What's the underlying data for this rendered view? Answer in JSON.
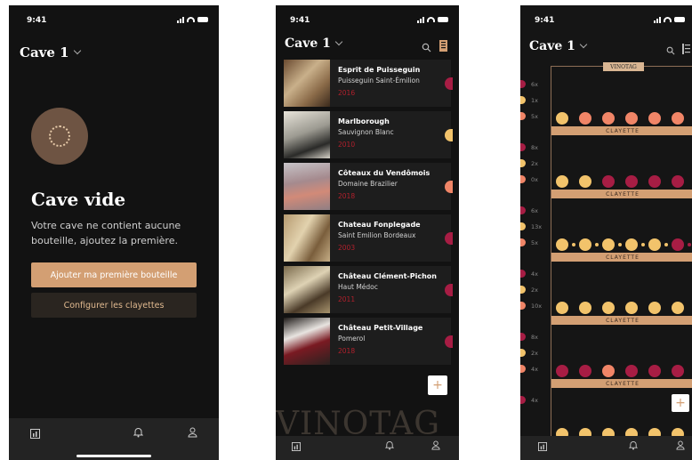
{
  "colors": {
    "accent": "#d39f73",
    "background": "#121212",
    "red_wine": "#a71d44",
    "white_wine": "#f2c36b",
    "rose_wine": "#f08567"
  },
  "status_time": "9:41",
  "screen1": {
    "cellar_name": "Cave 1",
    "empty_title": "Cave vide",
    "empty_message": "Votre cave ne contient aucune bouteille, ajoutez la première.",
    "add_button": "Ajouter ma première bouteille",
    "configure_button": "Configurer les clayettes"
  },
  "screen2": {
    "cellar_name": "Cave 1",
    "wines": [
      {
        "name": "Esprit de Puisseguin",
        "region": "Puisseguin Saint-Émilion",
        "year": "2016",
        "type": "red",
        "dot": "#a71d44"
      },
      {
        "name": "Marlborough",
        "region": "Sauvignon Blanc",
        "year": "2010",
        "type": "white",
        "dot": "#f2c36b"
      },
      {
        "name": "Côteaux du Vendômois",
        "region": "Domaine Brazilier",
        "year": "2018",
        "type": "rose",
        "dot": "#f08567"
      },
      {
        "name": "Chateau Fonplegade",
        "region": "Saint Emilion Bordeaux",
        "year": "2003",
        "type": "red",
        "dot": "#a71d44"
      },
      {
        "name": "Château Clément-Pichon",
        "region": "Haut Médoc",
        "year": "2011",
        "type": "red",
        "dot": "#a71d44"
      },
      {
        "name": "Château Petit-Village",
        "region": "Pomerol",
        "year": "2018",
        "type": "red",
        "dot": "#a71d44"
      }
    ],
    "watermark": "VINOTAG",
    "add_symbol": "+"
  },
  "screen3": {
    "cellar_name": "Cave 1",
    "rack_label": "VINOTAG",
    "shelf_label": "CLAYETTE",
    "add_symbol": "+",
    "shelves": [
      {
        "counts": [
          "6x",
          "1x",
          "5x"
        ],
        "bottles": [
          "white",
          "rose",
          "rose",
          "rose",
          "rose",
          "rose",
          "rose"
        ]
      },
      {
        "counts": [
          "8x",
          "2x",
          "0x"
        ],
        "bottles": [
          "white",
          "white",
          "red",
          "red",
          "red",
          "red",
          "red"
        ]
      },
      {
        "counts": [
          "6x",
          "13x",
          "5x"
        ],
        "bottles": [
          "white",
          "white",
          "white",
          "white",
          "white",
          "red",
          "red"
        ]
      },
      {
        "counts": [
          "4x",
          "2x",
          "10x"
        ],
        "bottles": [
          "white",
          "white",
          "white",
          "white",
          "white",
          "white",
          "white"
        ]
      },
      {
        "counts": [
          "8x",
          "2x",
          "4x"
        ],
        "bottles": [
          "red",
          "red",
          "rose",
          "red",
          "red",
          "red",
          "red"
        ]
      },
      {
        "counts": [
          "4x"
        ],
        "bottles": [
          "white",
          "white",
          "white",
          "white",
          "white",
          "white",
          "white"
        ]
      }
    ]
  }
}
